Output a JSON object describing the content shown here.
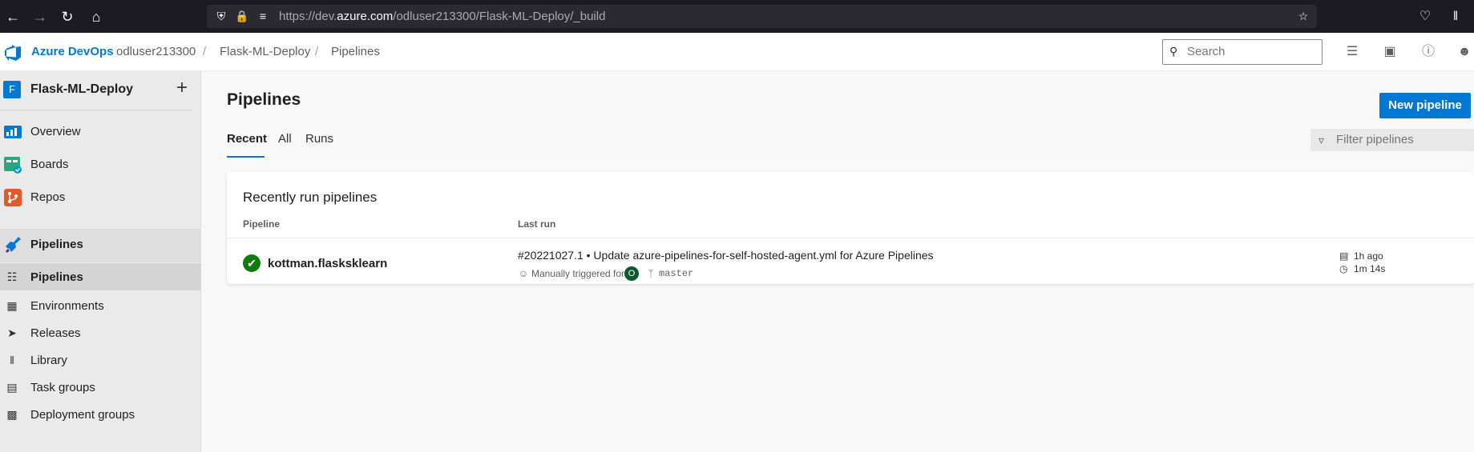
{
  "browser": {
    "url_prefix": "https://dev.",
    "url_domain": "azure.com",
    "url_path": "/odluser213300/Flask-ML-Deploy/_build"
  },
  "header": {
    "brand": "Azure DevOps",
    "breadcrumbs": [
      "odluser213300",
      "Flask-ML-Deploy",
      "Pipelines"
    ],
    "separator": "/",
    "search_placeholder": "Search"
  },
  "sidebar": {
    "project_initial": "F",
    "project_name": "Flask-ML-Deploy",
    "items": [
      {
        "label": "Overview"
      },
      {
        "label": "Boards"
      },
      {
        "label": "Repos"
      },
      {
        "label": "Pipelines"
      }
    ],
    "sub_items": [
      {
        "label": "Pipelines"
      },
      {
        "label": "Environments"
      },
      {
        "label": "Releases"
      },
      {
        "label": "Library"
      },
      {
        "label": "Task groups"
      },
      {
        "label": "Deployment groups"
      }
    ]
  },
  "main": {
    "title": "Pipelines",
    "new_button": "New pipeline",
    "tabs": [
      "Recent",
      "All",
      "Runs"
    ],
    "active_tab": "Recent",
    "filter_placeholder": "Filter pipelines",
    "card_title": "Recently run pipelines",
    "columns": {
      "pipeline": "Pipeline",
      "last_run": "Last run"
    },
    "rows": [
      {
        "status": "succeeded",
        "status_color": "#107c10",
        "name": "kottman.flasksklearn",
        "run_title": "#20221027.1 • Update azure-pipelines-for-self-hosted-agent.yml for Azure Pipelines",
        "trigger": "Manually triggered for",
        "avatar_initial": "O",
        "branch": "master",
        "ago": "1h ago",
        "duration": "1m 14s"
      }
    ]
  },
  "colors": {
    "accent": "#0078d4",
    "success": "#107c10",
    "browser_bg": "#1c1b22"
  }
}
